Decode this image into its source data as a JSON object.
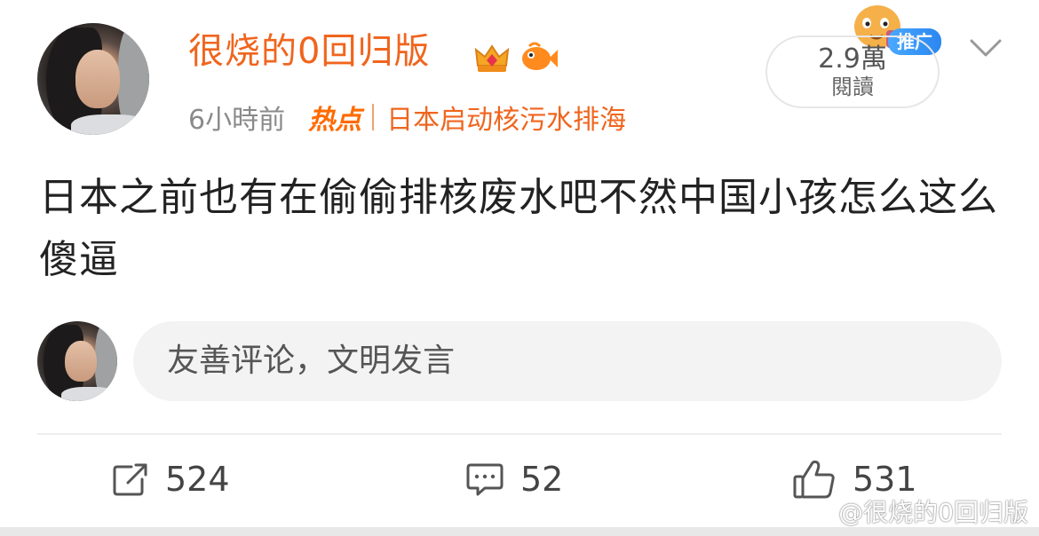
{
  "post": {
    "username": "很烧的0回归版",
    "time": "6小時前",
    "hot_tag": "热点",
    "topic": "日本启动核污水排海",
    "text": "日本之前也有在偷偷排核废水吧不然中国小孩怎么这么傻逼",
    "views": {
      "count": "2.9萬",
      "label": "閱讀"
    },
    "promo_badge": "推广"
  },
  "comment_box": {
    "placeholder": "友善评论，文明发言"
  },
  "actions": {
    "repost": "524",
    "comments": "52",
    "likes": "531"
  },
  "watermark": "@很烧的0回归版",
  "colors": {
    "username": "#f0651e",
    "hot_tag": "#ff6a00",
    "promo": "#2b86f0"
  },
  "icons": {
    "repost": "share-square-icon",
    "comment": "comment-bubble-icon",
    "like": "thumbs-up-icon",
    "crown": "crown-badge-icon",
    "fish": "fish-badge-icon",
    "menu": "chevron-down-icon"
  }
}
